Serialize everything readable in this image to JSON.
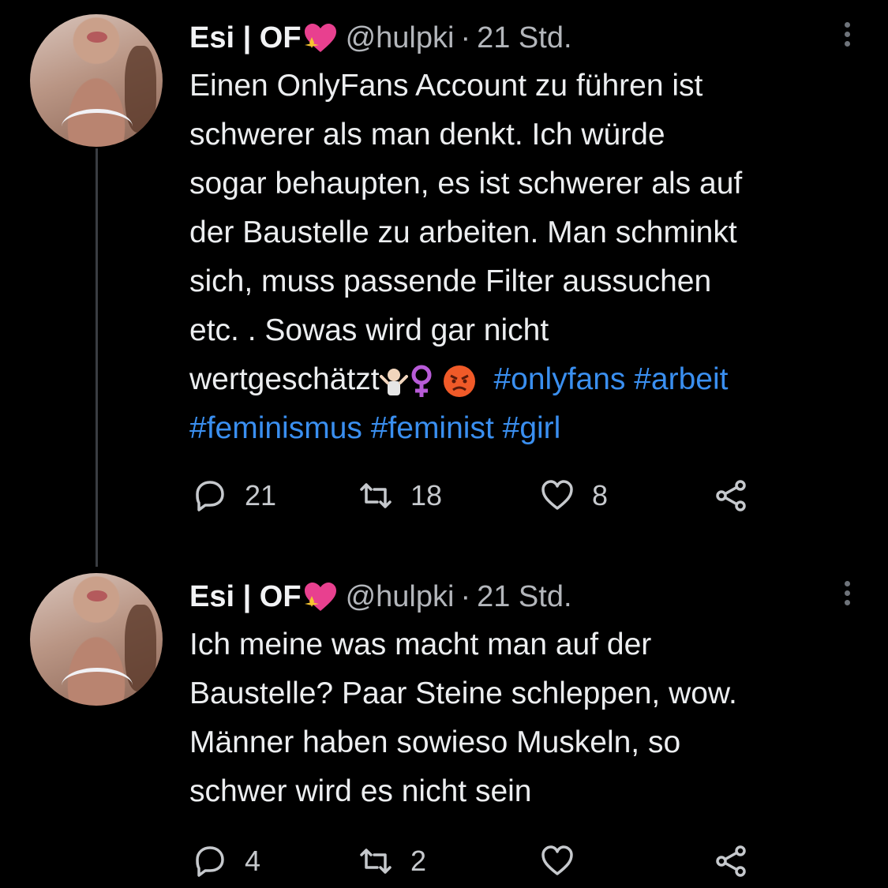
{
  "tweets": [
    {
      "author_name": "Esi | OF",
      "handle": "@hulpki",
      "separator": "·",
      "time": "21 Std.",
      "text_lines": [
        "Einen OnlyFans Account zu führen ist",
        "schwerer als man denkt. Ich würde",
        "sogar behaupten, es ist schwerer als auf",
        "der Baustelle zu arbeiten. Man schminkt",
        "sich, muss passende Filter aussuchen",
        "etc. . Sowas wird gar nicht"
      ],
      "last_line_text": "wertgeschätzt",
      "hashtags_line1": "#onlyfans #arbeit",
      "hashtags_line2": "#feminismus #feminist #girl",
      "reply_count": "21",
      "retweet_count": "18",
      "like_count": "8"
    },
    {
      "author_name": "Esi | OF",
      "handle": "@hulpki",
      "separator": "·",
      "time": "21 Std.",
      "text_lines": [
        "Ich meine was macht man auf der",
        "Baustelle? Paar Steine schleppen, wow.",
        "Männer haben sowieso Muskeln, so",
        "schwer wird es nicht sein"
      ],
      "reply_count": "4",
      "retweet_count": "2",
      "like_count": ""
    }
  ],
  "icons": {
    "name_emoji": "sparkling-heart-icon",
    "reply": "reply-icon",
    "retweet": "retweet-icon",
    "like": "heart-icon",
    "share": "share-icon",
    "more": "more-vertical-icon"
  },
  "colors": {
    "background": "#000000",
    "text": "#e9eaec",
    "muted": "#b3b6bb",
    "hashtag": "#3a8ff0",
    "heart_emoji": "#e8408f"
  }
}
